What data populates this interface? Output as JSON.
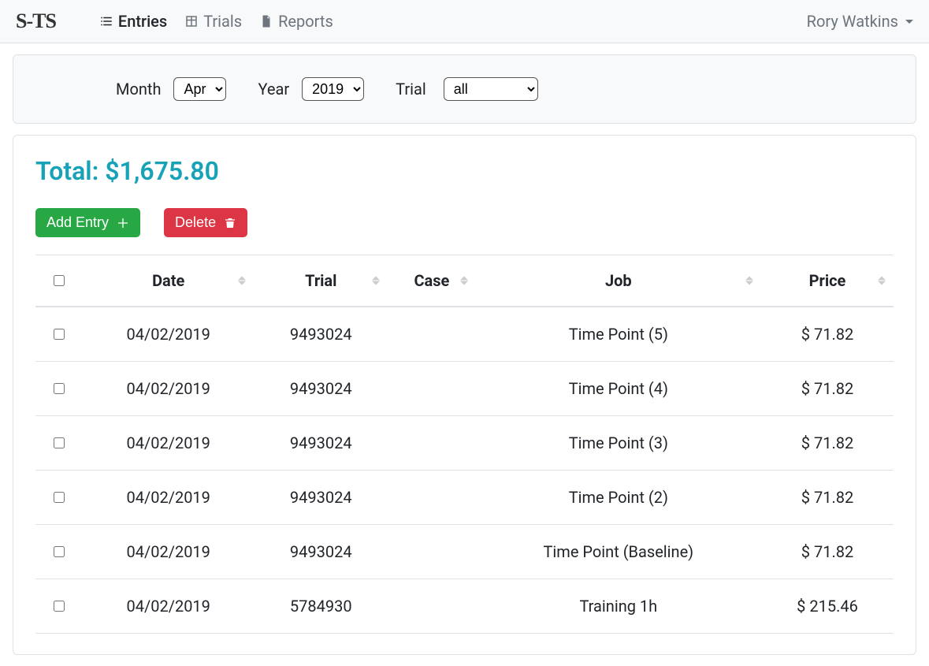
{
  "brand": "S-TS",
  "nav": {
    "entries": "Entries",
    "trials": "Trials",
    "reports": "Reports"
  },
  "user": {
    "name": "Rory Watkins"
  },
  "filters": {
    "month_label": "Month",
    "month_value": "Apr",
    "year_label": "Year",
    "year_value": "2019",
    "trial_label": "Trial",
    "trial_value": "all"
  },
  "total_label": "Total: $1,675.80",
  "buttons": {
    "add_entry": "Add Entry",
    "delete": "Delete"
  },
  "columns": {
    "date": "Date",
    "trial": "Trial",
    "case": "Case",
    "job": "Job",
    "price": "Price"
  },
  "rows": [
    {
      "date": "04/02/2019",
      "trial": "9493024",
      "case": "",
      "job": "Time Point (5)",
      "price": "$ 71.82"
    },
    {
      "date": "04/02/2019",
      "trial": "9493024",
      "case": "",
      "job": "Time Point (4)",
      "price": "$ 71.82"
    },
    {
      "date": "04/02/2019",
      "trial": "9493024",
      "case": "",
      "job": "Time Point (3)",
      "price": "$ 71.82"
    },
    {
      "date": "04/02/2019",
      "trial": "9493024",
      "case": "",
      "job": "Time Point (2)",
      "price": "$ 71.82"
    },
    {
      "date": "04/02/2019",
      "trial": "9493024",
      "case": "",
      "job": "Time Point (Baseline)",
      "price": "$ 71.82"
    },
    {
      "date": "04/02/2019",
      "trial": "5784930",
      "case": "",
      "job": "Training 1h",
      "price": "$ 215.46"
    }
  ]
}
